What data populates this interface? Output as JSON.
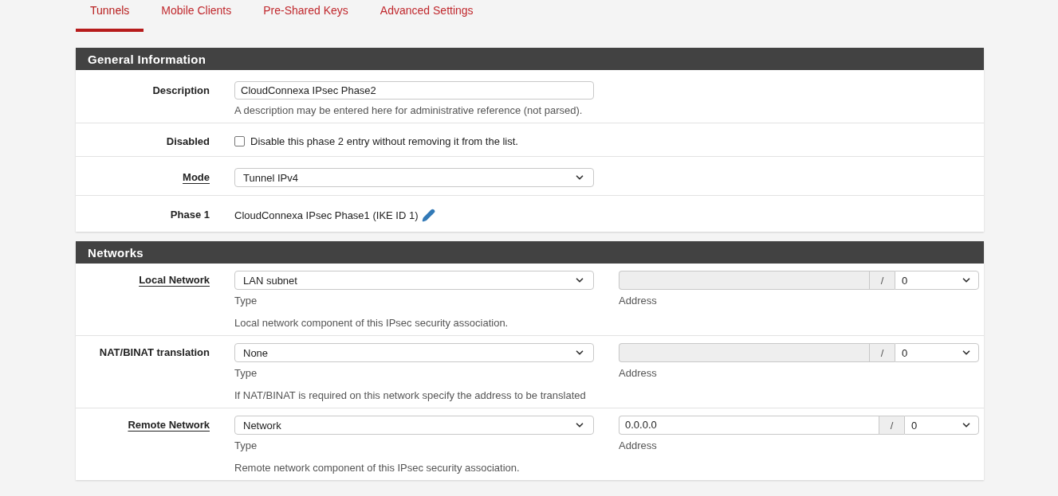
{
  "tabs": [
    {
      "label": "Tunnels",
      "selected": true
    },
    {
      "label": "Mobile Clients",
      "selected": false
    },
    {
      "label": "Pre-Shared Keys",
      "selected": false
    },
    {
      "label": "Advanced Settings",
      "selected": false
    }
  ],
  "sections": [
    {
      "title": "General Information",
      "rows": [
        {
          "kind": "text",
          "label": "Description",
          "help_link": false,
          "value": "CloudConnexa IPsec Phase2",
          "help": "A description may be entered here for administrative reference (not parsed)."
        },
        {
          "kind": "checkbox",
          "label": "Disabled",
          "help_link": false,
          "checked": false,
          "text": "Disable this phase 2 entry without removing it from the list."
        },
        {
          "kind": "select",
          "label": "Mode",
          "help_link": true,
          "value": "Tunnel IPv4"
        },
        {
          "kind": "link",
          "label": "Phase 1",
          "help_link": false,
          "text": "CloudConnexa IPsec Phase1 (IKE ID 1)"
        }
      ]
    },
    {
      "title": "Networks",
      "rows": [
        {
          "kind": "network",
          "label": "Local Network",
          "help_link": true,
          "type": "LAN subnet",
          "type_caption": "Type",
          "address": {
            "disabled": true,
            "separator": "/",
            "mask": "0"
          },
          "address_caption": "Address",
          "help": "Local network component of this IPsec security association."
        },
        {
          "kind": "network",
          "label": "NAT/BINAT translation",
          "help_link": false,
          "type": "None",
          "type_caption": "Type",
          "address": {
            "disabled": true,
            "separator": "/",
            "mask": "0"
          },
          "address_caption": "Address",
          "help": "If NAT/BINAT is required on this network specify the address to be translated"
        },
        {
          "kind": "network",
          "label": "Remote Network",
          "help_link": true,
          "type": "Network",
          "type_caption": "Type",
          "address": {
            "disabled": false,
            "value": "0.0.0.0",
            "separator": "/",
            "mask": "0"
          },
          "address_caption": "Address",
          "help": "Remote network component of this IPsec security association."
        }
      ]
    }
  ]
}
